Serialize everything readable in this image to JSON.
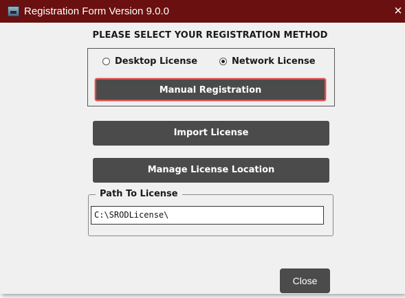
{
  "window": {
    "title": "Registration Form Version 9.0.0",
    "close_glyph": "×",
    "icon": "app-window-icon",
    "titlebar_color": "#6a1010"
  },
  "header": {
    "text": "PLEASE SELECT YOUR REGISTRATION METHOD"
  },
  "license_type": {
    "options": [
      {
        "label": "Desktop License",
        "selected": false
      },
      {
        "label": "Network License",
        "selected": true
      }
    ]
  },
  "buttons": {
    "manual_registration": "Manual Registration",
    "import_license": "Import License",
    "manage_location": "Manage License Location",
    "close": "Close"
  },
  "path": {
    "legend": "Path To License",
    "value": "C:\\SRODLicense\\"
  },
  "colors": {
    "button_bg": "#4b4b4b",
    "focus_border": "#e04a4a",
    "window_bg": "#f0f0f0"
  }
}
